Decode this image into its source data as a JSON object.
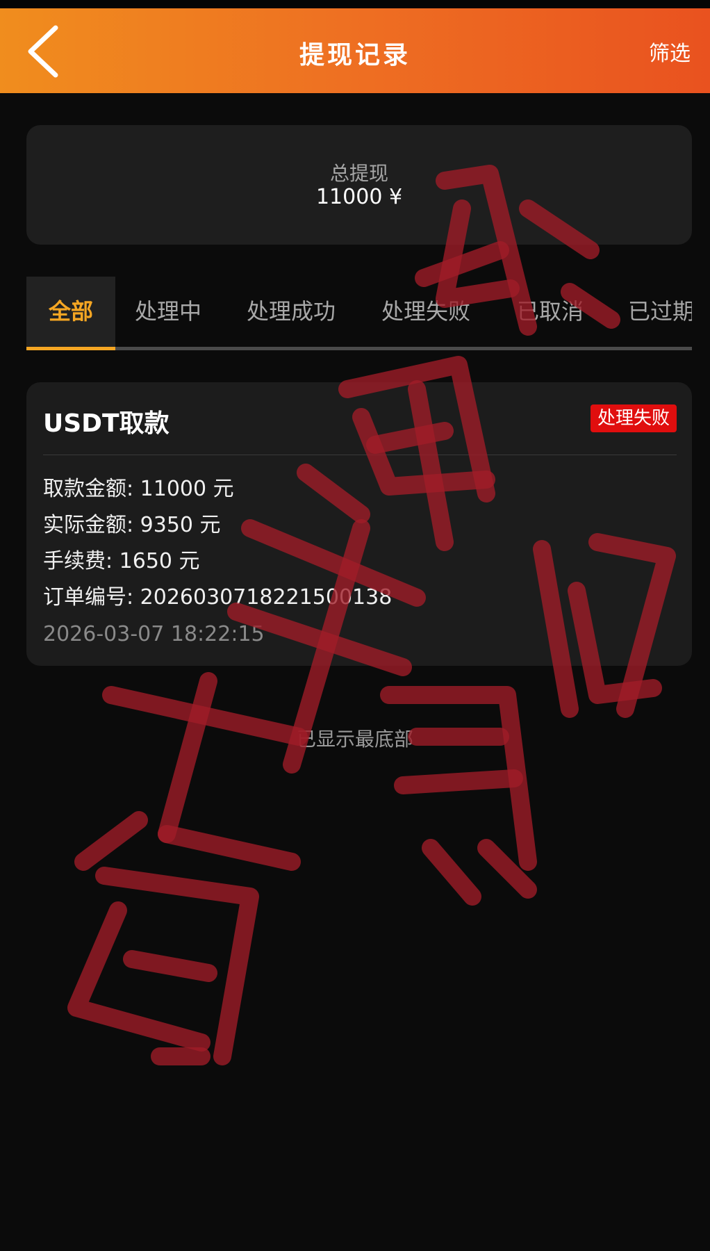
{
  "header": {
    "title": "提现记录",
    "filter_label": "筛选"
  },
  "summary": {
    "label": "总提现",
    "value": "11000 ¥"
  },
  "tabs": [
    {
      "label": "全部",
      "active": true
    },
    {
      "label": "处理中",
      "active": false
    },
    {
      "label": "处理成功",
      "active": false
    },
    {
      "label": "处理失败",
      "active": false
    },
    {
      "label": "已取消",
      "active": false
    },
    {
      "label": "已过期",
      "active": false
    }
  ],
  "record": {
    "title": "USDT取款",
    "status": "处理失败",
    "amount": "取款金额: 11000 元",
    "actual": "实际金额: 9350 元",
    "fee": "手续费: 1650 元",
    "order": "订单编号: 20260307182215001‍38",
    "time": "2026-03-07 18:22:15"
  },
  "end_text": "已显示最底部",
  "watermark": {
    "color": "#a01c28"
  },
  "colors": {
    "header_start": "#f08d1e",
    "header_end": "#e9521f",
    "accent": "#f5a623",
    "status_fail": "#e00e0e"
  }
}
